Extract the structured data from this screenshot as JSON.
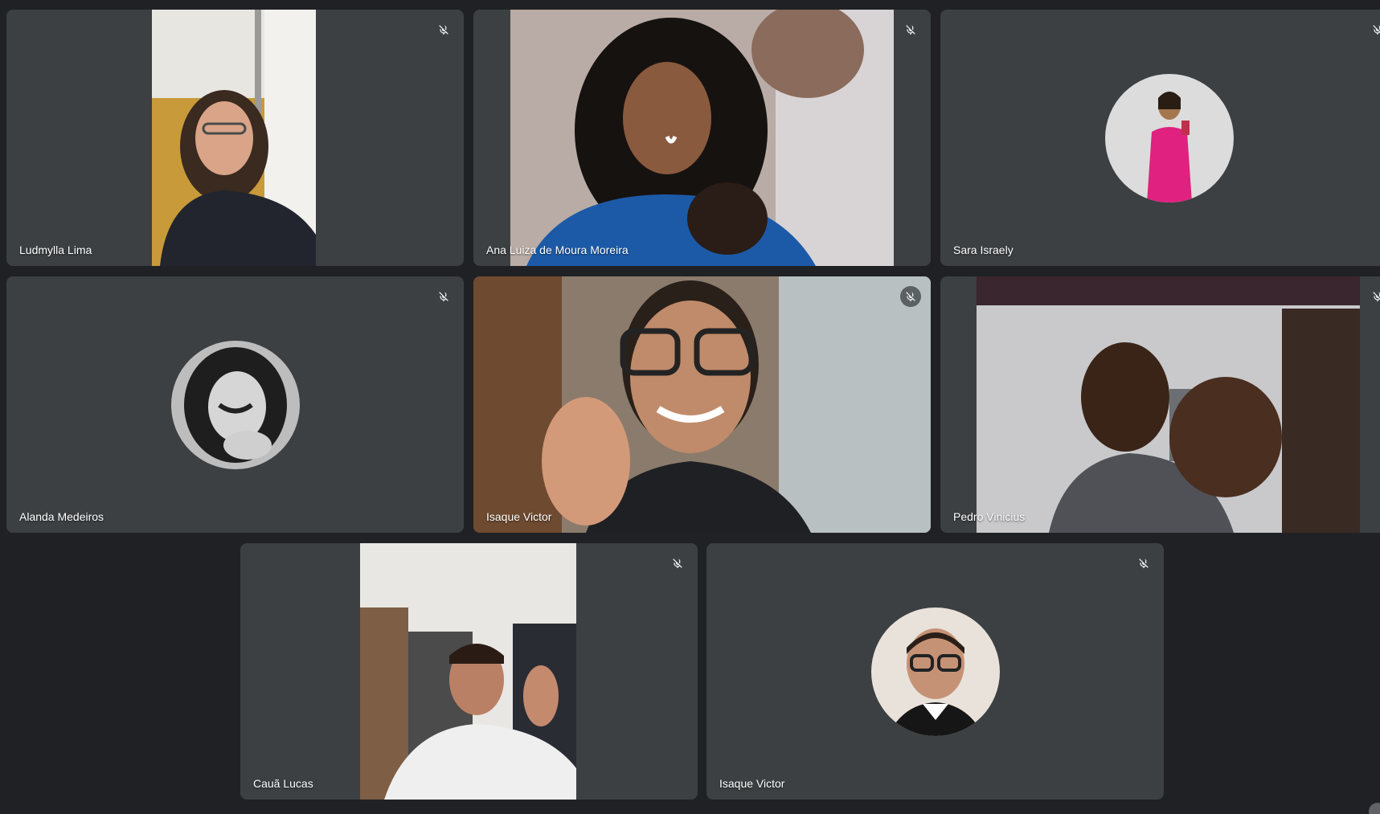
{
  "meeting": {
    "participants": [
      {
        "name": "Ludmylla Lima",
        "mic": "muted",
        "display": "video"
      },
      {
        "name": "Ana Luiza de Moura Moreira",
        "mic": "muted",
        "display": "video"
      },
      {
        "name": "Sara Israely",
        "mic": "muted",
        "display": "avatar"
      },
      {
        "name": "Alanda Medeiros",
        "mic": "muted",
        "display": "avatar"
      },
      {
        "name": "Isaque Victor",
        "mic": "muted",
        "display": "video"
      },
      {
        "name": "Pedro Vinicius",
        "mic": "muted",
        "display": "video"
      },
      {
        "name": "Cauã Lucas",
        "mic": "muted",
        "display": "video"
      },
      {
        "name": "Isaque Victor",
        "mic": "muted",
        "display": "avatar"
      }
    ]
  },
  "colors": {
    "page_background": "#202124",
    "tile_background": "#3c4043",
    "name_text": "#ffffff"
  },
  "icons": {
    "mute": "mic-off-icon"
  }
}
